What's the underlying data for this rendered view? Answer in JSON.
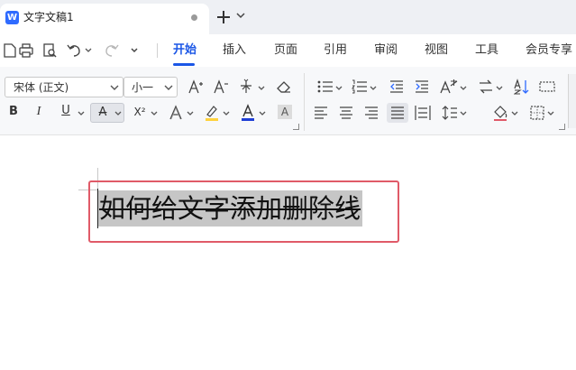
{
  "app": {
    "logo_letter": "W",
    "doc_tab_title": "文字文稿1"
  },
  "menu": {
    "items": [
      "开始",
      "插入",
      "页面",
      "引用",
      "审阅",
      "视图",
      "工具",
      "会员专享"
    ],
    "active": "开始"
  },
  "ribbon": {
    "font_name": "宋体 (正文)",
    "font_size": "小一",
    "underline_glyph": "U",
    "strikethrough_glyph": "A",
    "superscript_glyph": "X²",
    "shade_glyph": "A"
  },
  "document": {
    "selected_text": "如何给文字添加删除线"
  },
  "colors": {
    "accent": "#1a56e6",
    "font_color_bar": "#1f3fd6",
    "highlight_bar": "#ffd23c",
    "annotation_box": "#e05a68",
    "selection": "#c6c6c6"
  }
}
